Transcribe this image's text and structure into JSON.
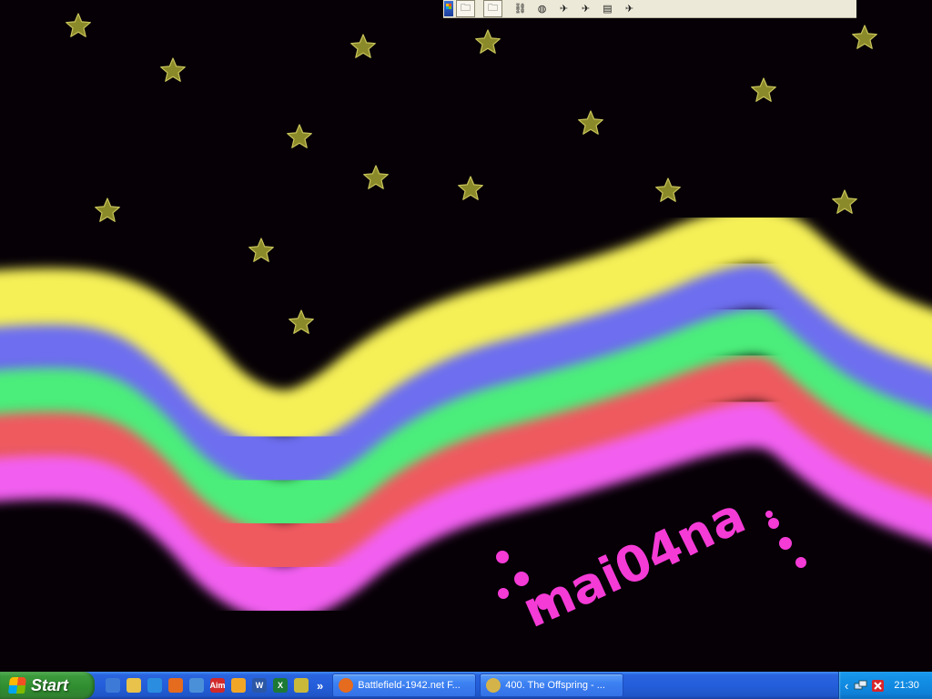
{
  "top_toolbar": {
    "buttons": [
      {
        "icon": "folder-icon"
      },
      {
        "icon": "folder-icon"
      },
      {
        "icon": "network-icon"
      },
      {
        "icon": "globe-icon"
      },
      {
        "icon": "game-icon"
      },
      {
        "icon": "game-icon"
      },
      {
        "icon": "document-icon"
      },
      {
        "icon": "game-icon"
      }
    ]
  },
  "wallpaper": {
    "signature_text": "mai04na",
    "star_color": "#8b8a2a",
    "rainbow_colors": [
      "#f5f056",
      "#6d6ef0",
      "#4cee7a",
      "#ef5a5e",
      "#f25ef0"
    ]
  },
  "taskbar": {
    "start_label": "Start",
    "quicklaunch_more": "»",
    "quicklaunch": [
      {
        "icon": "show-desktop-icon",
        "color": "#3d7ad8"
      },
      {
        "icon": "folder-icon",
        "color": "#e8c24a"
      },
      {
        "icon": "internet-explorer-icon",
        "color": "#2a8de0"
      },
      {
        "icon": "firefox-icon",
        "color": "#e56b1f"
      },
      {
        "icon": "phone-icon",
        "color": "#4a90d9"
      },
      {
        "icon": "aim-icon",
        "color": "#d22a2a",
        "text": "Aim"
      },
      {
        "icon": "media-player-icon",
        "color": "#f2a628"
      },
      {
        "icon": "word-icon",
        "color": "#2b57a5",
        "text": "W"
      },
      {
        "icon": "excel-icon",
        "color": "#1d7a36",
        "text": "X"
      },
      {
        "icon": "winamp-icon",
        "color": "#c9b93a"
      }
    ],
    "tasks": [
      {
        "label": "Battlefield-1942.net F...",
        "icon": "firefox-icon",
        "color": "#e56b1f"
      },
      {
        "label": "400. The Offspring - ...",
        "icon": "winamp-icon",
        "color": "#d4b44a"
      }
    ],
    "tray": {
      "arrow": "‹",
      "clock": "21:30"
    }
  }
}
